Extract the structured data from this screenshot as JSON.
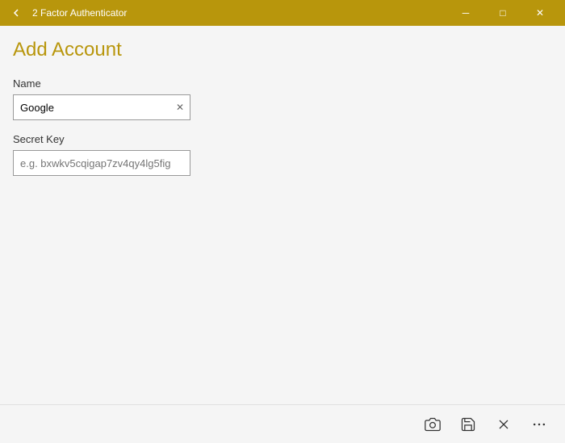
{
  "window": {
    "title": "2 Factor Authenticator",
    "titleBarColor": "#b8960c"
  },
  "titleBar": {
    "backLabel": "←",
    "minimizeLabel": "─",
    "maximizeLabel": "□",
    "closeLabel": "✕"
  },
  "page": {
    "title": "Add Account"
  },
  "form": {
    "nameLabel": "Name",
    "namePlaceholder": "",
    "nameValue": "Google",
    "secretKeyLabel": "Secret Key",
    "secretKeyPlaceholder": "e.g. bxwkv5cqigap7zv4qy4lg5fig"
  },
  "toolbar": {
    "cameraLabel": "📷",
    "saveLabel": "💾",
    "cancelLabel": "✕",
    "moreLabel": "···"
  }
}
